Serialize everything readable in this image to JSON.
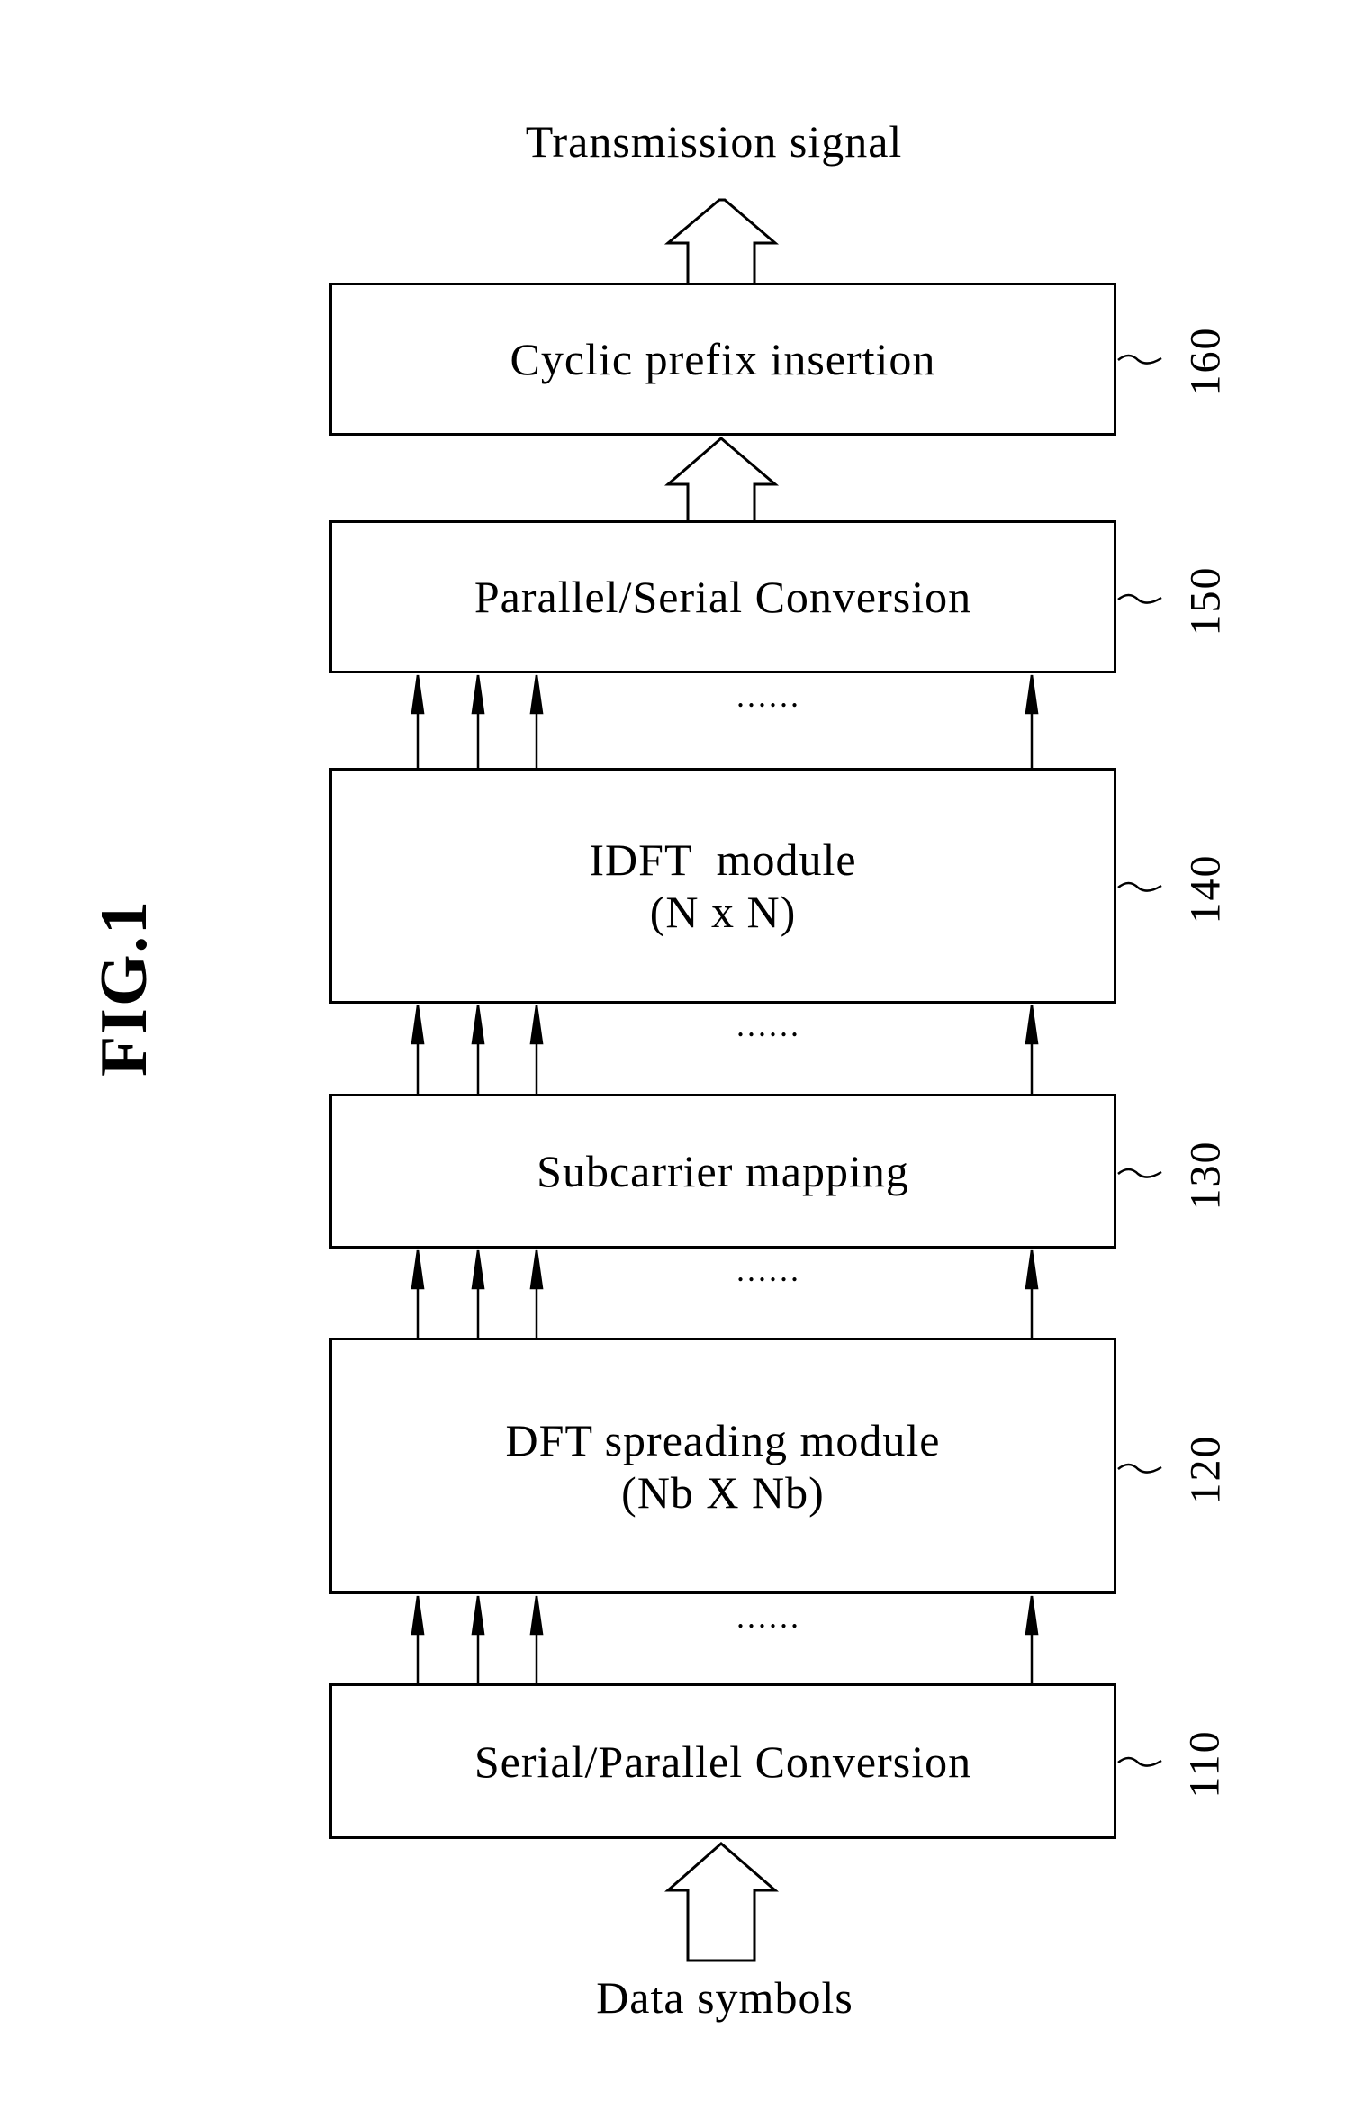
{
  "figure_label": "FIG.1",
  "output_label": "Transmission signal",
  "input_label": "Data symbols",
  "ellipsis": "......",
  "blocks": [
    {
      "ref": "160",
      "lines": [
        "Cyclic prefix insertion"
      ]
    },
    {
      "ref": "150",
      "lines": [
        "Parallel/Serial Conversion"
      ]
    },
    {
      "ref": "140",
      "lines": [
        "IDFT  module",
        "(N x N)"
      ]
    },
    {
      "ref": "130",
      "lines": [
        "Subcarrier mapping"
      ]
    },
    {
      "ref": "120",
      "lines": [
        "DFT spreading module",
        "(Nb X Nb)"
      ]
    },
    {
      "ref": "110",
      "lines": [
        "Serial/Parallel Conversion"
      ]
    }
  ]
}
